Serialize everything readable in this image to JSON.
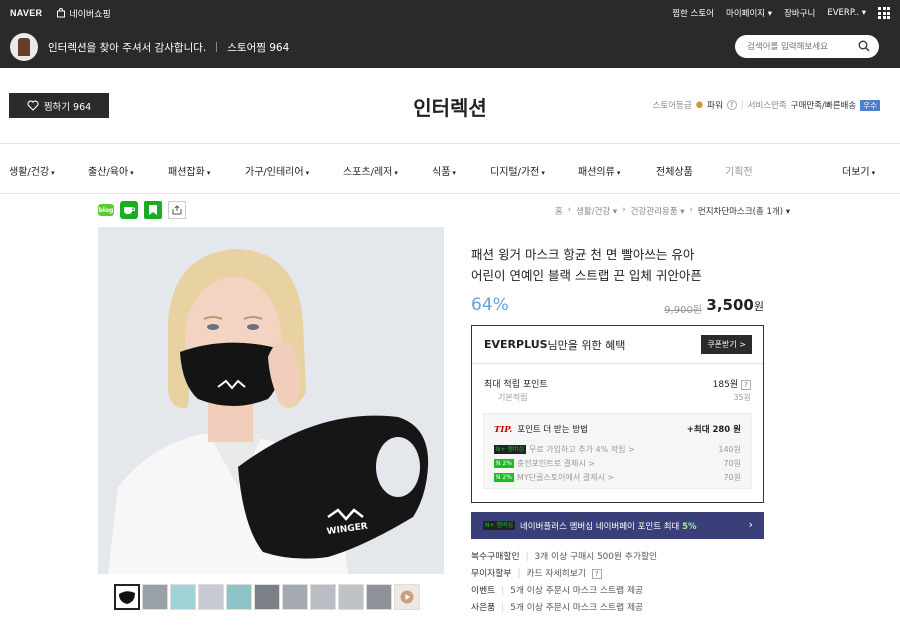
{
  "topbar": {
    "logo": "NAVER",
    "shopping": "네이버쇼핑",
    "links": [
      "찜한 스토어",
      "마이페이지",
      "장바구니",
      "EVERP.."
    ]
  },
  "storebar": {
    "greeting": "인터렉션을 찾아 주셔서 감사합니다.",
    "favorites": "스토어찜 964",
    "search_placeholder": "검색어를 입력해보세요"
  },
  "header": {
    "fav_button": "찜하기 964",
    "store_name": "인터렉션",
    "grade_label": "스토어등급",
    "grade_value": "파워",
    "service_label": "서비스만족",
    "service_value": "구매만족/빠른배송",
    "service_badge": "우수"
  },
  "nav": {
    "items": [
      {
        "label": "생활/건강"
      },
      {
        "label": "출산/육아"
      },
      {
        "label": "패션잡화"
      },
      {
        "label": "가구/인테리어"
      },
      {
        "label": "스포츠/레저"
      },
      {
        "label": "식품"
      },
      {
        "label": "디지털/가전"
      },
      {
        "label": "패션의류"
      },
      {
        "label": "전체상품"
      },
      {
        "label": "기획전"
      },
      {
        "label": "더보기"
      }
    ]
  },
  "breadcrumb": [
    "홈",
    "생활/건강",
    "건강관리용품",
    "먼지차단마스크(총 1개)"
  ],
  "product": {
    "title_line1": "패션 윙거 마스크 항균 천 면 빨아쓰는 유아",
    "title_line2": "어린이 연예인 블랙 스트랩 끈 입체 귀안아픈",
    "discount": "64%",
    "original_price": "9,900원",
    "sale_price": "3,500",
    "sale_unit": "원",
    "mask_logo_text": "WINGER"
  },
  "benefit": {
    "title_bold": "EVERPLUS",
    "title_rest": "님만을 위한 혜택",
    "coupon_button": "쿠폰받기 >",
    "max_points_label": "최대 적립 포인트",
    "max_points_value": "185원",
    "basic_label": "기본적립",
    "basic_value": "35원",
    "tip_label": "TIP.",
    "tip_text": "포인트 더 받는 방법",
    "tip_max": "+최대 280 원",
    "tip_rows": [
      {
        "badge": "N+ 멤버십",
        "text": "무료 가입하고 추가 4% 적립 >",
        "value": "140원"
      },
      {
        "badge": "N 2%",
        "text": "충전포인트로 결제시 >",
        "value": "70원"
      },
      {
        "badge": "N 2%",
        "text": "MY단골스토어에서 결제시 >",
        "value": "70원"
      }
    ]
  },
  "np_banner": {
    "badge": "N+ 멤버십",
    "text": "네이버플러스 멤버십 네이버페이 포인트 최대",
    "pct": "5%"
  },
  "extras": [
    {
      "k": "복수구매할인",
      "v": "3개 이상 구매시 500원 추가할인"
    },
    {
      "k": "무이자할부",
      "v": "카드 자세히보기"
    },
    {
      "k": "이벤트",
      "v": "5개 이상 주문시 마스크 스트랩 제공"
    },
    {
      "k": "사은품",
      "v": "5개 이상 주문시 마스크 스트랩 제공"
    }
  ]
}
